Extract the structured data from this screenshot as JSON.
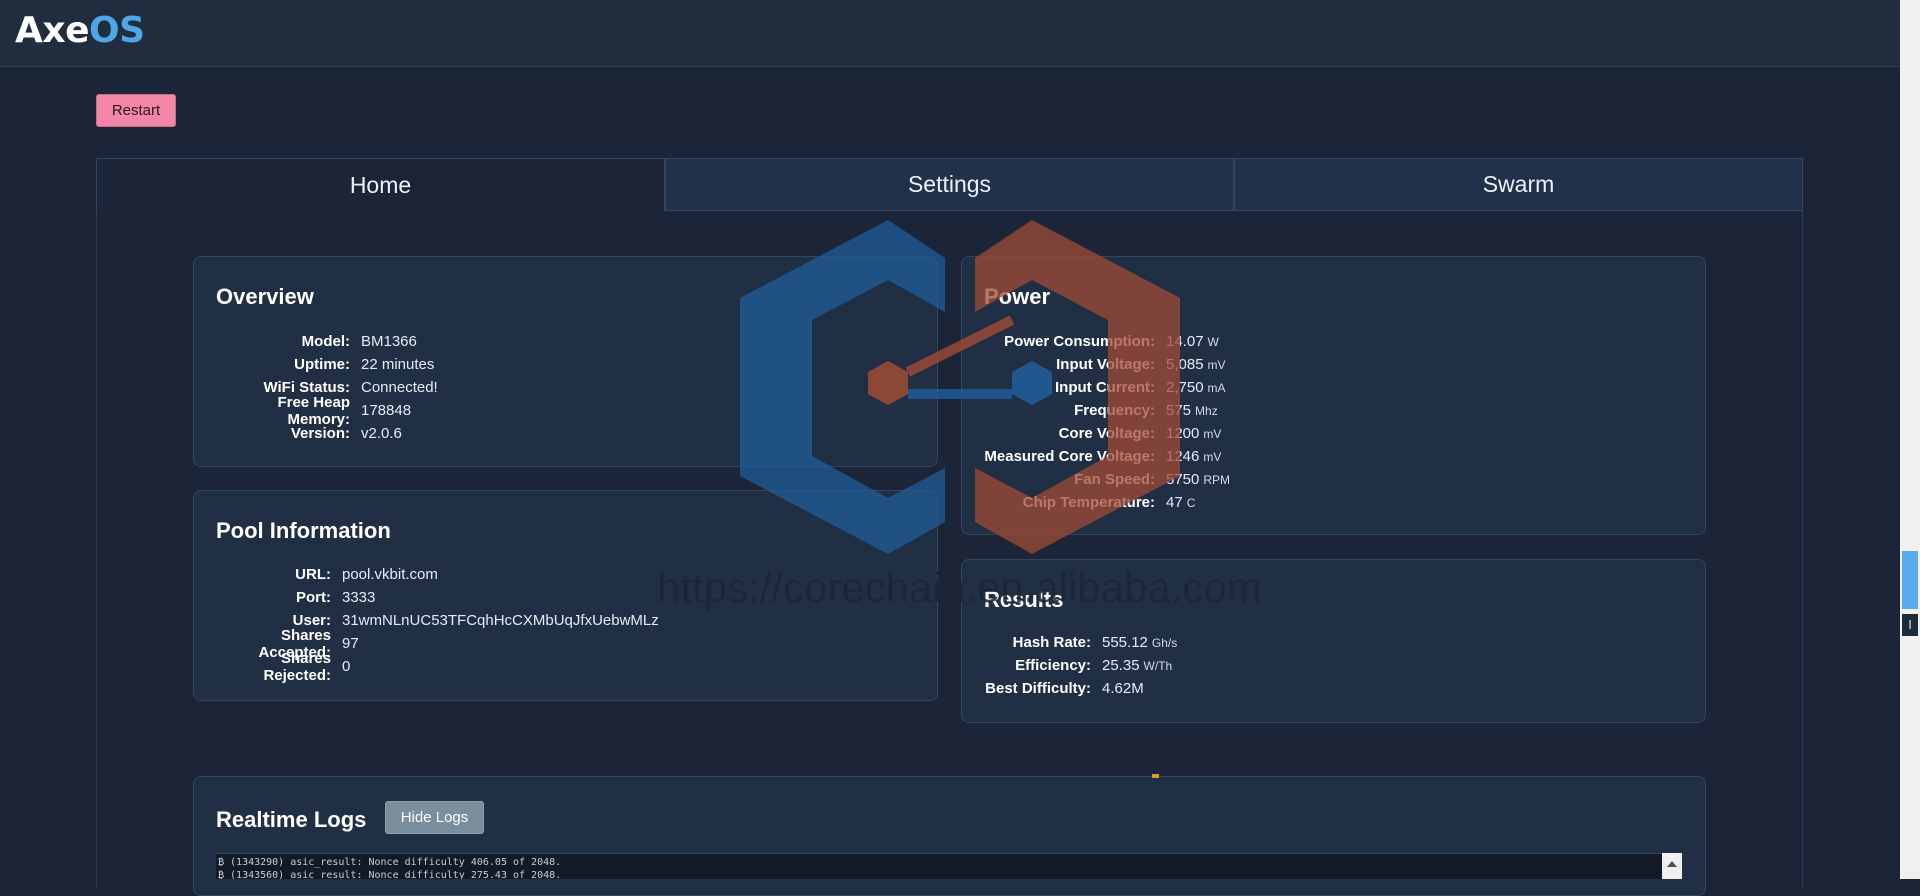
{
  "app": {
    "logo_primary": "Axe",
    "logo_secondary": "OS"
  },
  "toolbar": {
    "restart_label": "Restart"
  },
  "tabs": [
    {
      "label": "Home",
      "active": true
    },
    {
      "label": "Settings",
      "active": false
    },
    {
      "label": "Swarm",
      "active": false
    }
  ],
  "overview": {
    "title": "Overview",
    "rows": [
      {
        "key": "Model:",
        "value": "BM1366"
      },
      {
        "key": "Uptime:",
        "value": "22 minutes"
      },
      {
        "key": "WiFi Status:",
        "value": "Connected!"
      },
      {
        "key": "Free Heap Memory:",
        "value": "178848"
      },
      {
        "key": "Version:",
        "value": "v2.0.6"
      }
    ]
  },
  "power": {
    "title": "Power",
    "rows": [
      {
        "key": "Power Consumption:",
        "value": "14.07",
        "unit": "W"
      },
      {
        "key": "Input Voltage:",
        "value": "5,085",
        "unit": "mV"
      },
      {
        "key": "Input Current:",
        "value": "2,750",
        "unit": "mA"
      },
      {
        "key": "Frequency:",
        "value": "575",
        "unit": "Mhz"
      },
      {
        "key": "Core Voltage:",
        "value": "1200",
        "unit": "mV"
      },
      {
        "key": "Measured Core Voltage:",
        "value": "1246",
        "unit": "mV"
      },
      {
        "key": "Fan Speed:",
        "value": "5750",
        "unit": "RPM"
      },
      {
        "key": "Chip Temperature:",
        "value": "47",
        "unit": "C"
      }
    ]
  },
  "pool": {
    "title": "Pool Information",
    "rows": [
      {
        "key": "URL:",
        "value": "pool.vkbit.com"
      },
      {
        "key": "Port:",
        "value": "3333"
      },
      {
        "key": "User:",
        "value": "31wmNLnUC53TFCqhHcCXMbUqJfxUebwMLz"
      },
      {
        "key": "Shares Accepted:",
        "value": "97"
      },
      {
        "key": "Shares Rejected:",
        "value": "0"
      }
    ]
  },
  "results": {
    "title": "Results",
    "rows": [
      {
        "key": "Hash Rate:",
        "value": "555.12",
        "unit": "Gh/s"
      },
      {
        "key": "Efficiency:",
        "value": "25.35",
        "unit": "W/Th"
      },
      {
        "key": "Best Difficulty:",
        "value": "4.62M",
        "unit": ""
      }
    ]
  },
  "logs": {
    "title": "Realtime Logs",
    "hide_label": "Hide Logs",
    "lines": [
      "₿ (1343290) asic_result: Nonce difficulty 406.05 of 2048.",
      "₿ (1343560) asic_result: Nonce difficulty 275.43 of 2048."
    ]
  },
  "watermark": {
    "text": "https://corechain.en.alibaba.com"
  },
  "colors": {
    "background": "#1b2537",
    "card": "#212f45",
    "accent_blue": "#4ea5e8",
    "restart_pink": "#f386a7"
  }
}
